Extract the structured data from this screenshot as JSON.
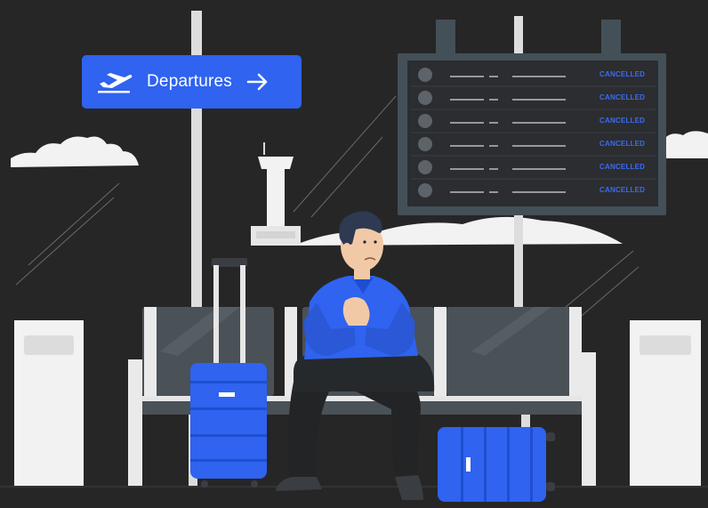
{
  "colors": {
    "background": "#262626",
    "accent_blue": "#2f63f0",
    "board_frame": "#445058",
    "board_screen": "#2b2d31",
    "seat_gray": "#4a5157",
    "cloud_white": "#f2f2f2"
  },
  "sign": {
    "label": "Departures",
    "icon": "airplane-takeoff-icon",
    "arrow_icon": "arrow-right-icon"
  },
  "board": {
    "rows": [
      {
        "status": "CANCELLED"
      },
      {
        "status": "CANCELLED"
      },
      {
        "status": "CANCELLED"
      },
      {
        "status": "CANCELLED"
      },
      {
        "status": "CANCELLED"
      },
      {
        "status": "CANCELLED"
      }
    ]
  }
}
